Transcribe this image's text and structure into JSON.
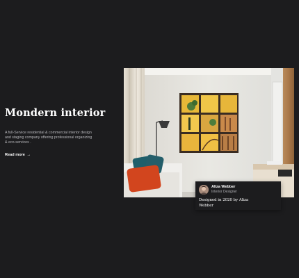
{
  "hero": {
    "title": "Mondern interior",
    "description": "A full-Service residential & commercial interior design and staging company offering professional organizing & eco-services .",
    "read_more_label": "Read more",
    "read_more_arrow": "→"
  },
  "photo": {
    "icon": "interior-photo"
  },
  "designer_card": {
    "name": "Aliza Webber",
    "role": "Interior Designer",
    "text": "Designed in 2020 by Aliza Webber"
  },
  "colors": {
    "background": "#1c1c1e",
    "text_primary": "#ffffff",
    "text_secondary": "#b9b9bd",
    "accent_yellow": "#e8b838",
    "pillow_orange": "#d2451e",
    "pillow_teal": "#1f5f6b"
  }
}
